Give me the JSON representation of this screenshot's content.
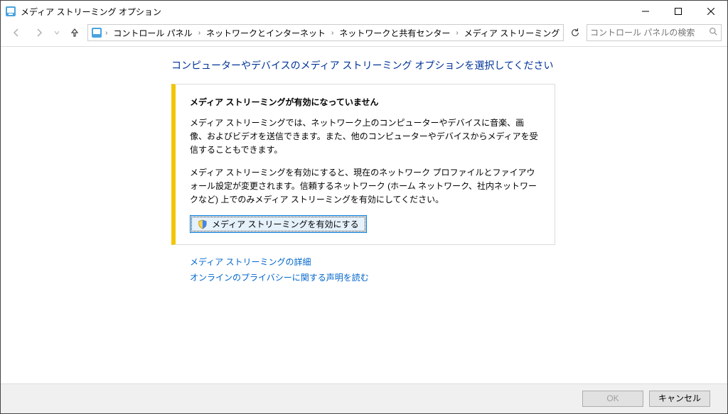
{
  "window": {
    "title": "メディア ストリーミング オプション"
  },
  "breadcrumb": {
    "items": [
      "コントロール パネル",
      "ネットワークとインターネット",
      "ネットワークと共有センター",
      "メディア ストリーミング オプション"
    ]
  },
  "search": {
    "placeholder": "コントロール パネルの検索"
  },
  "content": {
    "heading": "コンピューターやデバイスのメディア ストリーミング オプションを選択してください",
    "box_title": "メディア ストリーミングが有効になっていません",
    "box_p1": "メディア ストリーミングでは、ネットワーク上のコンピューターやデバイスに音楽、画像、およびビデオを送信できます。また、他のコンピューターやデバイスからメディアを受信することもできます。",
    "box_p2": "メディア ストリーミングを有効にすると、現在のネットワーク プロファイルとファイアウォール設定が変更されます。信頼するネットワーク (ホーム ネットワーク、社内ネットワークなど) 上でのみメディア ストリーミングを有効にしてください。",
    "enable_button": "メディア ストリーミングを有効にする",
    "link1": "メディア ストリーミングの詳細",
    "link2": "オンラインのプライバシーに関する声明を読む"
  },
  "bottom": {
    "ok": "OK",
    "cancel": "キャンセル"
  }
}
